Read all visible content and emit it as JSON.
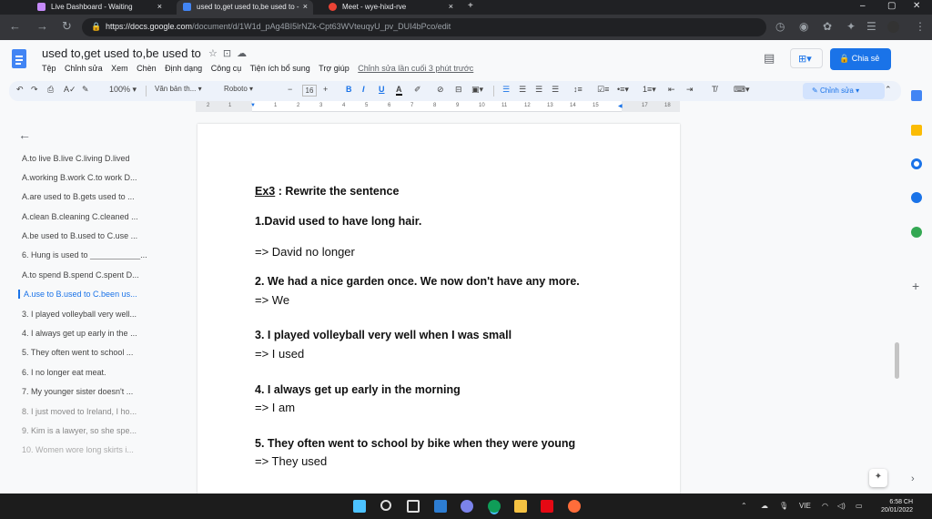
{
  "browser": {
    "tabs": [
      {
        "title": "Live Dashboard - Waiting",
        "active": false
      },
      {
        "title": "used to,get used to,be used to -",
        "active": true
      },
      {
        "title": "Meet - wye-hixd-rve",
        "active": false
      }
    ],
    "new_tab": "+",
    "url_host": "https://docs.google.com",
    "url_path": "/document/d/1W1d_pAg4BI5lrNZk-Cpt63WVteuqyU_pv_DUI4bPco/edit"
  },
  "doc": {
    "title": "used to,get used to,be used to",
    "menu": [
      "Tệp",
      "Chỉnh sửa",
      "Xem",
      "Chèn",
      "Định dạng",
      "Công cụ",
      "Tiện ích bổ sung",
      "Trợ giúp"
    ],
    "last_edit": "Chỉnh sửa lần cuối 3 phút trước",
    "share_label": "Chia sẻ"
  },
  "toolbar": {
    "zoom": "100%",
    "style": "Văn bản th...",
    "font": "Roboto",
    "font_size": "16",
    "minus": "−",
    "plus": "+",
    "bold": "B",
    "italic": "I",
    "underline": "U",
    "text_color": "A",
    "mode": "Chỉnh sửa"
  },
  "ruler": [
    "2",
    "1",
    "1",
    "2",
    "3",
    "4",
    "5",
    "6",
    "7",
    "8",
    "9",
    "10",
    "11",
    "12",
    "13",
    "14",
    "15",
    "16",
    "17",
    "18"
  ],
  "outline": [
    "A.to live B.live C.living D.lived",
    "A.working B.work C.to work D...",
    "A.are used to B.gets used to ...",
    "A.clean B.cleaning C.cleaned ...",
    "A.be used to B.used to C.use ...",
    "6. Hung is used to ___________...",
    "A.to spend B.spend C.spent D...",
    "A.use to B.used to C.been us...",
    "3. I played volleyball very well...",
    "4. I always get up early in the ...",
    "5. They often went to school ...",
    "6. I no longer eat meat.",
    "7. My younger sister doesn't ...",
    "8. I just moved to Ireland, I ho...",
    "9. Kim is a lawyer, so she spe...",
    "10. Women wore long skirts i..."
  ],
  "body": {
    "heading_ex": "Ex3",
    "heading_rest": " : Rewrite the sentence",
    "lines": [
      {
        "text": "1.David used to have long hair.",
        "bold": true
      },
      {
        "text": "=> David no longer",
        "bold": false
      },
      {
        "text": "2. We had a nice garden once. We now don't have any more.",
        "bold": true
      },
      {
        "text": "=> We",
        "bold": false
      },
      {
        "text": "3. I played volleyball very well when I was small",
        "bold": true
      },
      {
        "text": "=> I used",
        "bold": false
      },
      {
        "text": "4. I always get up early in the morning",
        "bold": true
      },
      {
        "text": "=> I am",
        "bold": false
      },
      {
        "text": "5. They often went to school by bike when they were young",
        "bold": true
      },
      {
        "text": "=> They used",
        "bold": false
      }
    ]
  },
  "taskbar": {
    "language": "VIE",
    "time": "6:58 CH",
    "date": "20/01/2022"
  }
}
